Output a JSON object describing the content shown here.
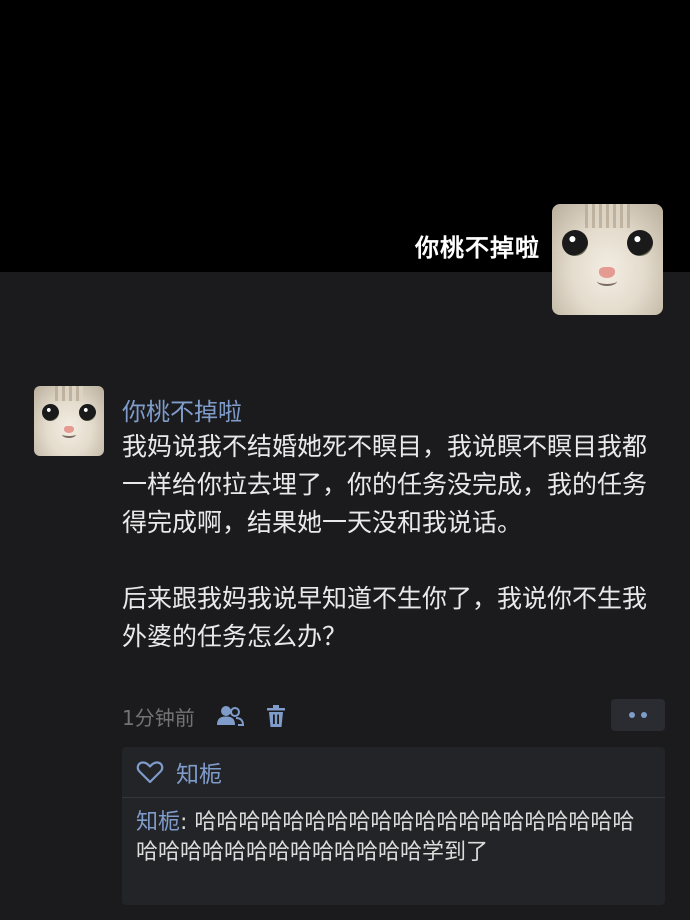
{
  "header": {
    "title": "你桃不掉啦"
  },
  "post": {
    "author": "你桃不掉啦",
    "paragraphs": [
      "我妈说我不结婚她死不瞑目，我说瞑不瞑目我都一样给你拉去埋了，你的任务没完成，我的任务得完成啊，结果她一天没和我说话。",
      "后来跟我妈我说早知道不生你了，我说你不生我外婆的任务怎么办？"
    ],
    "time": "1分钟前"
  },
  "likes": {
    "names": "知栀"
  },
  "comment": {
    "author": "知栀",
    "separator": ": ",
    "text": "哈哈哈哈哈哈哈哈哈哈哈哈哈哈哈哈哈哈哈哈哈哈哈哈哈哈哈哈哈哈哈哈哈学到了"
  },
  "colors": {
    "accent": "#7f9ccb",
    "background": "#1b1b1d",
    "header_background": "#000000",
    "panel_background": "#232427"
  },
  "icons": [
    "user-permissions-icon",
    "trash-icon",
    "more-icon",
    "heart-icon"
  ]
}
